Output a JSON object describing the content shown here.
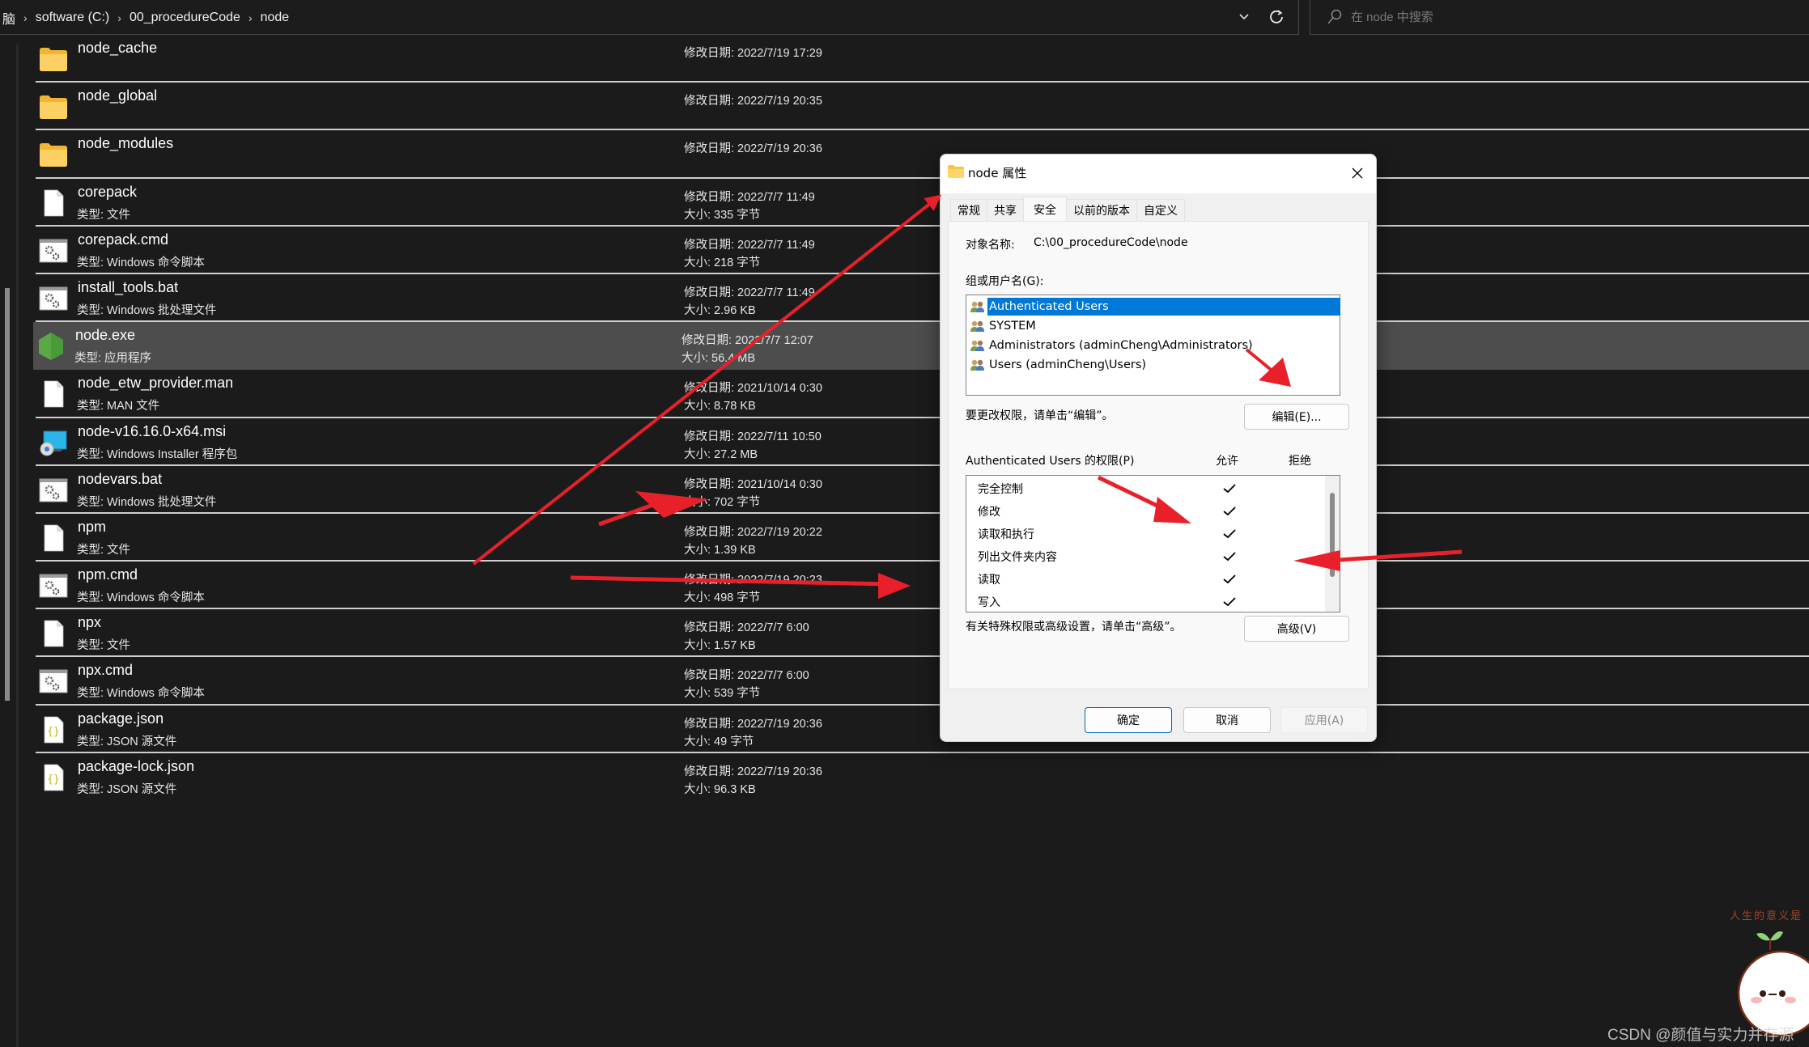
{
  "address_bar": {
    "breadcrumbs": [
      "脑",
      "software (C:)",
      "00_procedureCode",
      "node"
    ],
    "dropdown_icon": "chevron-down-icon",
    "refresh_icon": "refresh-icon"
  },
  "search": {
    "placeholder": "在 node 中搜索",
    "icon": "search-icon"
  },
  "files": [
    {
      "name": "node_cache",
      "kind": "folder",
      "type": "",
      "date": "修改日期: 2022/7/19 17:29",
      "size": ""
    },
    {
      "name": "node_global",
      "kind": "folder",
      "type": "",
      "date": "修改日期: 2022/7/19 20:35",
      "size": ""
    },
    {
      "name": "node_modules",
      "kind": "folder",
      "type": "",
      "date": "修改日期: 2022/7/19 20:36",
      "size": ""
    },
    {
      "name": "corepack",
      "kind": "file",
      "type": "类型: 文件",
      "date": "修改日期: 2022/7/7 11:49",
      "size": "大小: 335 字节"
    },
    {
      "name": "corepack.cmd",
      "kind": "script",
      "type": "类型: Windows 命令脚本",
      "date": "修改日期: 2022/7/7 11:49",
      "size": "大小: 218 字节"
    },
    {
      "name": "install_tools.bat",
      "kind": "script",
      "type": "类型: Windows 批处理文件",
      "date": "修改日期: 2022/7/7 11:49",
      "size": "大小: 2.96 KB"
    },
    {
      "name": "node.exe",
      "kind": "exe",
      "type": "类型: 应用程序",
      "date": "修改日期: 2022/7/7 12:07",
      "size": "大小: 56.4 MB",
      "selected": true
    },
    {
      "name": "node_etw_provider.man",
      "kind": "file",
      "type": "类型: MAN 文件",
      "date": "修改日期: 2021/10/14 0:30",
      "size": "大小: 8.78 KB"
    },
    {
      "name": "node-v16.16.0-x64.msi",
      "kind": "msi",
      "type": "类型: Windows Installer 程序包",
      "date": "修改日期: 2022/7/11 10:50",
      "size": "大小: 27.2 MB"
    },
    {
      "name": "nodevars.bat",
      "kind": "script",
      "type": "类型: Windows 批处理文件",
      "date": "修改日期: 2021/10/14 0:30",
      "size": "大小: 702 字节"
    },
    {
      "name": "npm",
      "kind": "file",
      "type": "类型: 文件",
      "date": "修改日期: 2022/7/19 20:22",
      "size": "大小: 1.39 KB"
    },
    {
      "name": "npm.cmd",
      "kind": "script",
      "type": "类型: Windows 命令脚本",
      "date": "修改日期: 2022/7/19 20:23",
      "size": "大小: 498 字节"
    },
    {
      "name": "npx",
      "kind": "file",
      "type": "类型: 文件",
      "date": "修改日期: 2022/7/7 6:00",
      "size": "大小: 1.57 KB"
    },
    {
      "name": "npx.cmd",
      "kind": "script",
      "type": "类型: Windows 命令脚本",
      "date": "修改日期: 2022/7/7 6:00",
      "size": "大小: 539 字节"
    },
    {
      "name": "package.json",
      "kind": "json",
      "type": "类型: JSON 源文件",
      "date": "修改日期: 2022/7/19 20:36",
      "size": "大小: 49 字节"
    },
    {
      "name": "package-lock.json",
      "kind": "json",
      "type": "类型: JSON 源文件",
      "date": "修改日期: 2022/7/19 20:36",
      "size": "大小: 96.3 KB"
    }
  ],
  "dialog": {
    "title": "node 属性",
    "tabs": [
      {
        "label": "常规",
        "active": false
      },
      {
        "label": "共享",
        "active": false
      },
      {
        "label": "安全",
        "active": true
      },
      {
        "label": "以前的版本",
        "active": false
      },
      {
        "label": "自定义",
        "active": false
      }
    ],
    "object_name_label": "对象名称:",
    "object_name_value": "C:\\00_procedureCode\\node",
    "group_label": "组或用户名(G):",
    "users": [
      {
        "name": "Authenticated Users",
        "selected": true
      },
      {
        "name": "SYSTEM",
        "selected": false
      },
      {
        "name": "Administrators (adminCheng\\Administrators)",
        "selected": false
      },
      {
        "name": "Users (adminCheng\\Users)",
        "selected": false
      }
    ],
    "edit_hint": "要更改权限，请单击“编辑”。",
    "edit_button": "编辑(E)...",
    "perm_header": "Authenticated Users 的权限(P)",
    "allow_header": "允许",
    "deny_header": "拒绝",
    "permissions": [
      {
        "name": "完全控制",
        "allow": true,
        "deny": false
      },
      {
        "name": "修改",
        "allow": true,
        "deny": false
      },
      {
        "name": "读取和执行",
        "allow": true,
        "deny": false
      },
      {
        "name": "列出文件夹内容",
        "allow": true,
        "deny": false
      },
      {
        "name": "读取",
        "allow": true,
        "deny": false
      },
      {
        "name": "写入",
        "allow": true,
        "deny": false
      }
    ],
    "advanced_hint": "有关特殊权限或高级设置，请单击“高级”。",
    "advanced_button": "高级(V)",
    "ok_button": "确定",
    "cancel_button": "取消",
    "apply_button": "应用(A)"
  },
  "annotation_color": "#e8202a",
  "watermark": {
    "text": "CSDN @颜值与实力并存源",
    "motto": "人生的意义是"
  }
}
